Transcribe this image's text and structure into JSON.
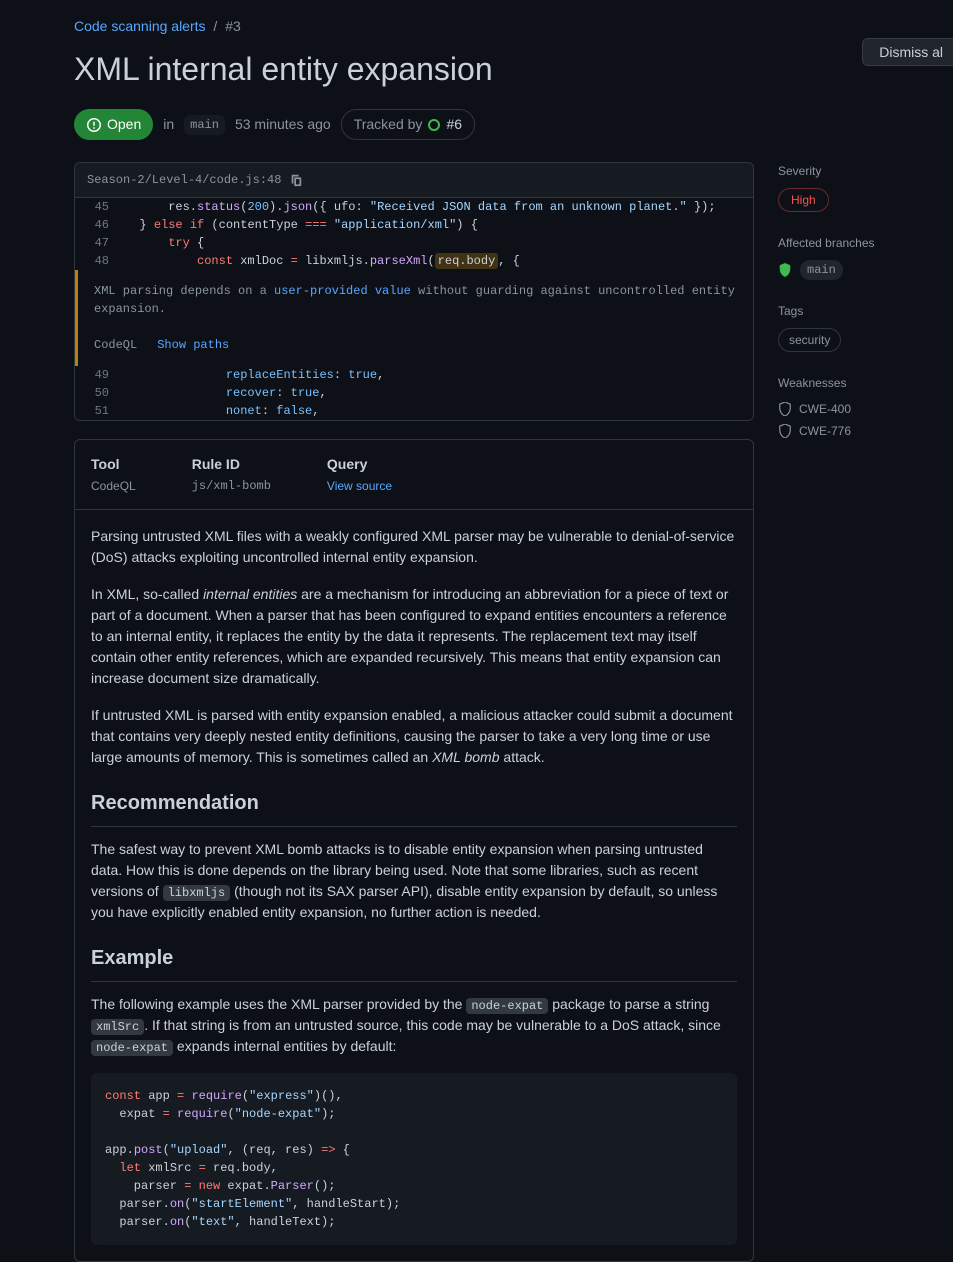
{
  "breadcrumb": {
    "parent": "Code scanning alerts",
    "separator": "/",
    "current": "#3"
  },
  "title": "XML internal entity expansion",
  "status": {
    "label": "Open",
    "branch_prefix": "in",
    "branch": "main",
    "age": "53 minutes ago"
  },
  "tracked": {
    "prefix": "Tracked by",
    "issue": "#6"
  },
  "dismiss_btn": "Dismiss al",
  "code_header": {
    "path": "Season-2/Level-4/code.js:48"
  },
  "code_lines": [
    {
      "num": "45",
      "html": "      res.<span class='fn'>status</span>(<span class='num'>200</span>).<span class='fn'>json</span>({ <span class='ident'>ufo</span>: <span class='str'>\"Received JSON data from an unknown planet.\"</span> });"
    },
    {
      "num": "46",
      "html": "  } <span class='kw'>else if</span> (contentType <span class='kw'>===</span> <span class='str'>\"application/xml\"</span>) {"
    },
    {
      "num": "47",
      "html": "      <span class='kw'>try</span> {"
    },
    {
      "num": "48",
      "html": "          <span class='kw'>const</span> xmlDoc <span class='kw'>=</span> libxmljs.<span class='fn'>parseXml</span>(<span class='hl'>req.body</span>, {"
    }
  ],
  "alert": {
    "msg_pre": "XML parsing depends on a ",
    "msg_link": "user-provided value",
    "msg_post": " without guarding against uncontrolled entity expansion.",
    "tool": "CodeQL",
    "showpaths": "Show paths"
  },
  "code_lines2": [
    {
      "num": "49",
      "html": "              <span class='prop'>replaceEntities</span>: <span class='bool'>true</span>,"
    },
    {
      "num": "50",
      "html": "              <span class='prop'>recover</span>: <span class='bool'>true</span>,"
    },
    {
      "num": "51",
      "html": "              <span class='prop'>nonet</span>: <span class='bool'>false</span>,"
    }
  ],
  "info": {
    "cols": [
      {
        "label": "Tool",
        "value": "CodeQL",
        "cls": ""
      },
      {
        "label": "Rule ID",
        "value": "js/xml-bomb",
        "cls": "mono"
      },
      {
        "label": "Query",
        "value": "View source",
        "cls": "link"
      }
    ],
    "paras": [
      "Parsing untrusted XML files with a weakly configured XML parser may be vulnerable to denial-of-service (DoS) attacks exploiting uncontrolled internal entity expansion.",
      "In XML, so-called <em>internal entities</em> are a mechanism for introducing an abbreviation for a piece of text or part of a document. When a parser that has been configured to expand entities encounters a reference to an internal entity, it replaces the entity by the data it represents. The replacement text may itself contain other entity references, which are expanded recursively. This means that entity expansion can increase document size dramatically.",
      "If untrusted XML is parsed with entity expansion enabled, a malicious attacker could submit a document that contains very deeply nested entity definitions, causing the parser to take a very long time or use large amounts of memory. This is sometimes called an <em>XML bomb</em> attack."
    ],
    "rec_heading": "Recommendation",
    "rec_text": "The safest way to prevent XML bomb attacks is to disable entity expansion when parsing untrusted data. How this is done depends on the library being used. Note that some libraries, such as recent versions of <span class='code-inline'>libxmljs</span> (though not its SAX parser API), disable entity expansion by default, so unless you have explicitly enabled entity expansion, no further action is needed.",
    "ex_heading": "Example",
    "ex_text": "The following example uses the XML parser provided by the <span class='code-inline'>node-expat</span> package to parse a string <span class='code-inline'>xmlSrc</span>. If that string is from an untrusted source, this code may be vulnerable to a DoS attack, since <span class='code-inline'>node-expat</span> expands internal entities by default:",
    "ex_code": "<span class='kw'>const</span> app <span class='kw'>=</span> <span class='fn'>require</span>(<span class='str'>\"express\"</span>)(),\n  expat <span class='kw'>=</span> <span class='fn'>require</span>(<span class='str'>\"node-expat\"</span>);\n\napp.<span class='fn'>post</span>(<span class='str'>\"upload\"</span>, (req, res) <span class='kw'>=&gt;</span> {\n  <span class='kw'>let</span> xmlSrc <span class='kw'>=</span> req.body,\n    parser <span class='kw'>=</span> <span class='kw'>new</span> expat.<span class='fn'>Parser</span>();\n  parser.<span class='fn'>on</span>(<span class='str'>\"startElement\"</span>, handleStart);\n  parser.<span class='fn'>on</span>(<span class='str'>\"text\"</span>, handleText);"
  },
  "sidebar": {
    "severity_label": "Severity",
    "severity_value": "High",
    "branches_label": "Affected branches",
    "branches_value": "main",
    "tags_label": "Tags",
    "tags_value": "security",
    "weaknesses_label": "Weaknesses",
    "weaknesses": [
      "CWE-400",
      "CWE-776"
    ]
  }
}
